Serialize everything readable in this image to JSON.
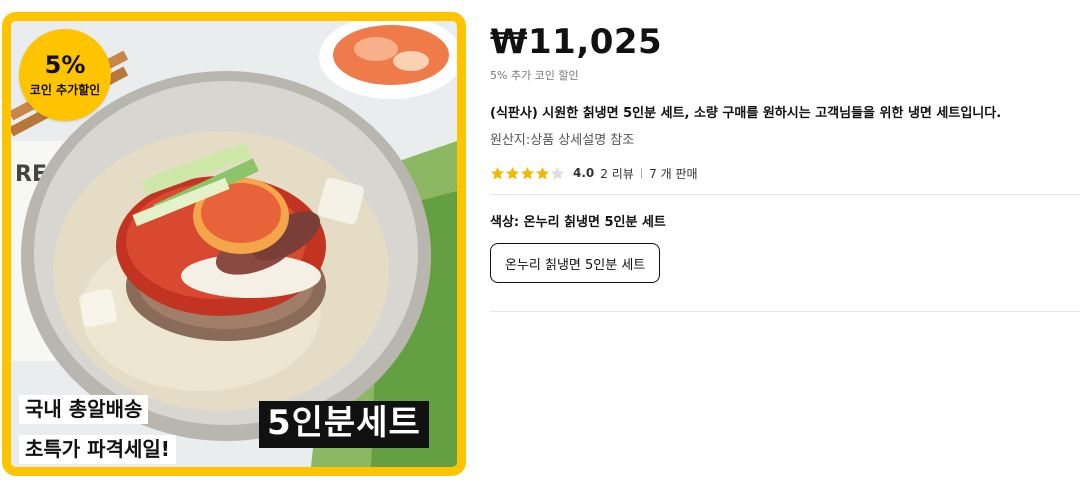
{
  "product_image": {
    "badge_percent": "5%",
    "badge_label": "코인 추가할인",
    "promo_line_1": "국내 총알배송",
    "promo_line_2": "초특가 파격세일!",
    "set_label": "5인분세트"
  },
  "product": {
    "price": "₩11,025",
    "coin_discount": "5% 추가 코인 할인",
    "title": "(식판사) 시원한 칡냉면 5인분 세트, 소량 구매를 원하시는 고객님들을 위한 냉면 세트입니다.",
    "origin": "원산지:상품 상세설명 참조",
    "rating": {
      "value": "4.0",
      "stars_filled": 4,
      "stars_total": 5,
      "reviews": "2 리뷰",
      "sales": "7 개 판매"
    },
    "option_label": "색상: 온누리 칡냉면 5인분 세트",
    "option_selected": "온누리 칡냉면 5인분 세트"
  },
  "colors": {
    "accent": "#ffc400",
    "star_filled": "#f5b800",
    "star_empty": "#dddddd"
  }
}
